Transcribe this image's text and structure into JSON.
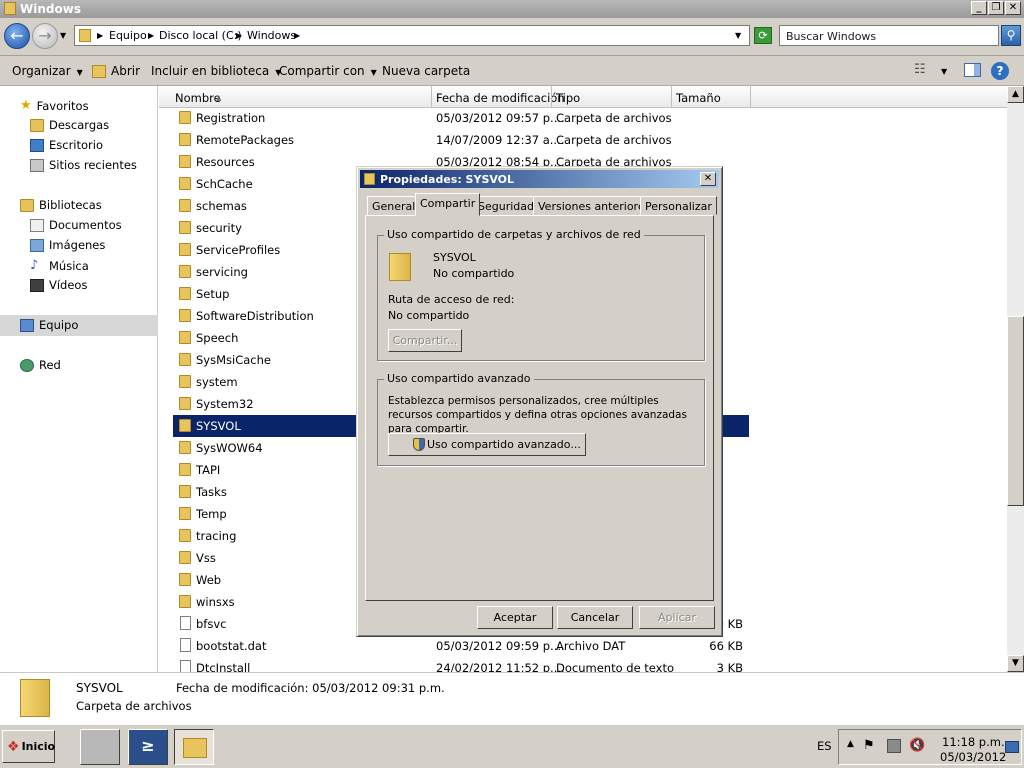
{
  "window": {
    "title": "Windows"
  },
  "address": {
    "crumbs": [
      "Equipo",
      "Disco local (C:)",
      "Windows"
    ],
    "search_placeholder": "Buscar Windows"
  },
  "toolbar": {
    "organize": "Organizar",
    "open": "Abrir",
    "include": "Incluir en biblioteca",
    "share": "Compartir con",
    "new_folder": "Nueva carpeta"
  },
  "nav": {
    "favorites": "Favoritos",
    "downloads": "Descargas",
    "desktop": "Escritorio",
    "recent": "Sitios recientes",
    "libraries": "Bibliotecas",
    "documents": "Documentos",
    "images": "Imágenes",
    "music": "Música",
    "videos": "Vídeos",
    "computer": "Equipo",
    "network": "Red"
  },
  "columns": {
    "name": "Nombre",
    "date": "Fecha de modificación",
    "type": "Tipo",
    "size": "Tamaño"
  },
  "files": [
    {
      "name": "Registration",
      "date": "05/03/2012 09:57 p....",
      "type": "Carpeta de archivos",
      "size": ""
    },
    {
      "name": "RemotePackages",
      "date": "14/07/2009 12:37 a....",
      "type": "Carpeta de archivos",
      "size": ""
    },
    {
      "name": "Resources",
      "date": "05/03/2012 08:54 p....",
      "type": "Carpeta de archivos",
      "size": ""
    },
    {
      "name": "SchCache",
      "date": "",
      "type": "",
      "size": ""
    },
    {
      "name": "schemas",
      "date": "",
      "type": "",
      "size": ""
    },
    {
      "name": "security",
      "date": "",
      "type": "",
      "size": ""
    },
    {
      "name": "ServiceProfiles",
      "date": "",
      "type": "",
      "size": ""
    },
    {
      "name": "servicing",
      "date": "",
      "type": "",
      "size": ""
    },
    {
      "name": "Setup",
      "date": "",
      "type": "",
      "size": ""
    },
    {
      "name": "SoftwareDistribution",
      "date": "",
      "type": "",
      "size": ""
    },
    {
      "name": "Speech",
      "date": "",
      "type": "",
      "size": ""
    },
    {
      "name": "SysMsiCache",
      "date": "",
      "type": "",
      "size": ""
    },
    {
      "name": "system",
      "date": "",
      "type": "",
      "size": ""
    },
    {
      "name": "System32",
      "date": "",
      "type": "",
      "size": ""
    },
    {
      "name": "SYSVOL",
      "date": "",
      "type": "",
      "size": ""
    },
    {
      "name": "SysWOW64",
      "date": "",
      "type": "",
      "size": ""
    },
    {
      "name": "TAPI",
      "date": "",
      "type": "",
      "size": ""
    },
    {
      "name": "Tasks",
      "date": "",
      "type": "",
      "size": ""
    },
    {
      "name": "Temp",
      "date": "",
      "type": "",
      "size": ""
    },
    {
      "name": "tracing",
      "date": "",
      "type": "",
      "size": ""
    },
    {
      "name": "Vss",
      "date": "",
      "type": "",
      "size": ""
    },
    {
      "name": "Web",
      "date": "",
      "type": "",
      "size": ""
    },
    {
      "name": "winsxs",
      "date": "",
      "type": "",
      "size": ""
    },
    {
      "name": "bfsvc",
      "date": "",
      "type": "",
      "size": "0 KB"
    },
    {
      "name": "bootstat.dat",
      "date": "05/03/2012 09:59 p....",
      "type": "Archivo DAT",
      "size": "66 KB"
    },
    {
      "name": "DtcInstall",
      "date": "24/02/2012 11:52 p....",
      "type": "Documento de texto",
      "size": "3 KB"
    }
  ],
  "details": {
    "name": "SYSVOL",
    "modified": "Fecha de modificación: 05/03/2012 09:31 p.m.",
    "type": "Carpeta de archivos"
  },
  "dialog": {
    "title": "Propiedades: SYSVOL",
    "tabs": [
      "General",
      "Compartir",
      "Seguridad",
      "Versiones anteriores",
      "Personalizar"
    ],
    "group1_title": "Uso compartido de carpetas y archivos de red",
    "folder_name": "SYSVOL",
    "folder_status": "No compartido",
    "path_label": "Ruta de acceso de red:",
    "path_value": "No compartido",
    "share_button": "Compartir...",
    "group2_title": "Uso compartido avanzado",
    "group2_desc": "Establezca permisos personalizados, cree múltiples recursos compartidos y defina otras opciones avanzadas para compartir.",
    "advanced_button": "Uso compartido avanzado...",
    "ok": "Aceptar",
    "cancel": "Cancelar",
    "apply": "Aplicar"
  },
  "taskbar": {
    "start": "Inicio",
    "lang": "ES",
    "time": "11:18 p.m.",
    "date": "05/03/2012"
  }
}
